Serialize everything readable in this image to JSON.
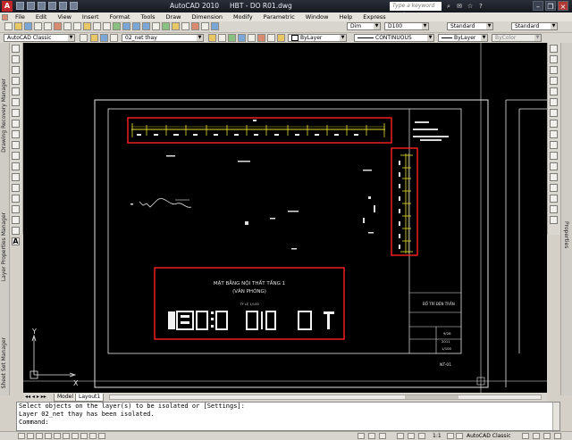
{
  "window": {
    "app_title": "AutoCAD 2010",
    "file_title": "HBT - DO R01.dwg",
    "help_placeholder": "Type a keyword or phrase",
    "app_icon_letter": "A"
  },
  "menu": [
    "File",
    "Edit",
    "View",
    "Insert",
    "Format",
    "Tools",
    "Draw",
    "Dimension",
    "Modify",
    "Parametric",
    "Window",
    "Help",
    "Express"
  ],
  "toolbar1": {
    "dim_style": "Dim",
    "dim_scale": "D100",
    "text_style": "Standard",
    "table_style": "Standard"
  },
  "toolbar2": {
    "workspace": "AutoCAD Classic",
    "layer": "02_net thay",
    "color": "ByLayer",
    "linetype": "CONTINUOUS",
    "lineweight": "ByLayer",
    "plotstyle": "ByColor"
  },
  "side_panels": {
    "left_tool_palettes": [
      "Drawing Recovery Manager",
      "Layer Properties Manager",
      "Sheet Set Manager"
    ],
    "right_palette": "Properties"
  },
  "drawing": {
    "title_main": "MẶT BẰNG NỘI THẤT TẦNG 1",
    "title_sub": "(VĂN PHÒNG)",
    "scale_note": "TỶ LỆ 1/100",
    "axis_y": "Y",
    "axis_x": "X",
    "titleblock_name": "BỐ TRÍ ĐÈN TRẦN",
    "titleblock_sheet": "NT-01",
    "titleblock_date": "2011",
    "titleblock_scale": "1/100",
    "titleblock_no": "9/28"
  },
  "tabs": {
    "model": "Model",
    "layout": "Layout1"
  },
  "command_lines": [
    "Select objects on the layer(s) to be isolated or [Settings]:",
    "Layer 02_net thay has been isolated.",
    "Command:"
  ],
  "status": {
    "scale": "1:1",
    "workspace": "AutoCAD Classic"
  },
  "colors": {
    "highlight_box": "#ff2020",
    "cad_yellow": "#e8e030",
    "cad_white": "#e6e6e6"
  }
}
